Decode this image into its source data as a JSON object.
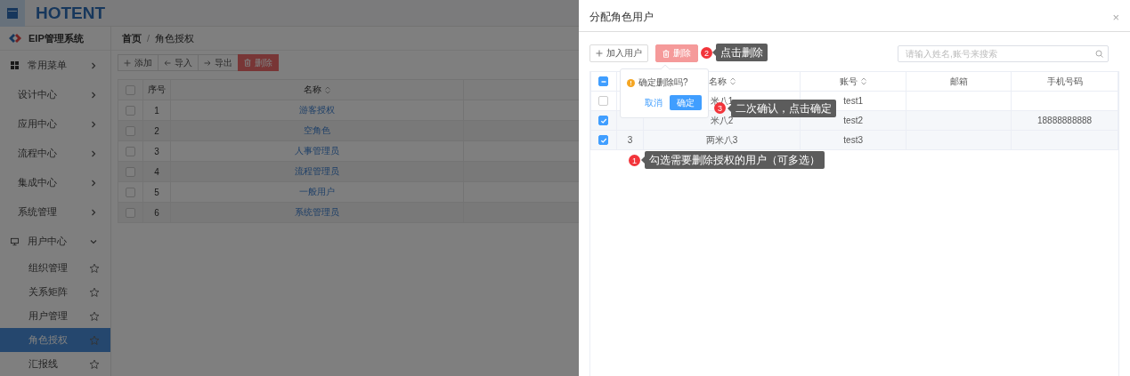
{
  "header": {
    "logo": "HOTENT"
  },
  "sidebar": {
    "system_name": "EIP管理系统",
    "items": [
      {
        "label": "常用菜单",
        "kind": "shortcuts",
        "expanded": false
      },
      {
        "label": "设计中心",
        "kind": "module",
        "expanded": false
      },
      {
        "label": "应用中心",
        "kind": "module",
        "expanded": false
      },
      {
        "label": "流程中心",
        "kind": "module",
        "expanded": false
      },
      {
        "label": "集成中心",
        "kind": "module",
        "expanded": false
      },
      {
        "label": "系统管理",
        "kind": "module",
        "expanded": false
      },
      {
        "label": "用户中心",
        "kind": "account",
        "expanded": true,
        "children": [
          {
            "label": "组织管理",
            "selected": false
          },
          {
            "label": "关系矩阵",
            "selected": false
          },
          {
            "label": "用户管理",
            "selected": false
          },
          {
            "label": "角色授权",
            "selected": true
          },
          {
            "label": "汇报线",
            "selected": false
          }
        ]
      }
    ]
  },
  "breadcrumb": {
    "items": [
      "首页",
      "角色授权"
    ],
    "separator": "/"
  },
  "toolbar": [
    {
      "label": "添加",
      "kind": "add"
    },
    {
      "label": "导入",
      "kind": "import"
    },
    {
      "label": "导出",
      "kind": "export"
    },
    {
      "label": "删除",
      "kind": "delete"
    }
  ],
  "table": {
    "header_checked": false,
    "columns": [
      "序号",
      "名称"
    ],
    "rows": [
      {
        "index": "1",
        "name": "游客授权",
        "checked": false
      },
      {
        "index": "2",
        "name": "空角色",
        "checked": false
      },
      {
        "index": "3",
        "name": "人事管理员",
        "checked": false
      },
      {
        "index": "4",
        "name": "流程管理员",
        "checked": false
      },
      {
        "index": "5",
        "name": "一般用户",
        "checked": false
      },
      {
        "index": "6",
        "name": "系统管理员",
        "checked": false
      }
    ]
  },
  "drawer": {
    "title": "分配角色用户",
    "close": "×",
    "toolbar": [
      {
        "label": "加入用户",
        "kind": "add"
      },
      {
        "label": "删除",
        "kind": "delete"
      }
    ],
    "search": {
      "placeholder": "请输入姓名,账号来搜索"
    },
    "table": {
      "header_checkbox": {
        "indeterminate": true
      },
      "columns": [
        {
          "label": "名称",
          "sortable": true
        },
        {
          "label": "账号",
          "sortable": true
        },
        {
          "label": "邮箱",
          "sortable": false
        },
        {
          "label": "手机号码",
          "sortable": false
        }
      ],
      "rows": [
        {
          "checked": false,
          "name": "米八1",
          "account": "test1"
        },
        {
          "checked": true,
          "name": "米八2",
          "account": "test2",
          "phone": "18888888888"
        },
        {
          "checked": true,
          "index": "3",
          "name": "两米八3",
          "account": "test3"
        }
      ]
    },
    "popover": {
      "message": "确定删除吗?",
      "cancel": "取消",
      "confirm": "确定"
    },
    "annotations": [
      {
        "number": "2",
        "text": "点击删除"
      },
      {
        "number": "3",
        "text": "二次确认，点击确定"
      },
      {
        "number": "1",
        "text": "勾选需要删除授权的用户（可多选）"
      }
    ]
  }
}
